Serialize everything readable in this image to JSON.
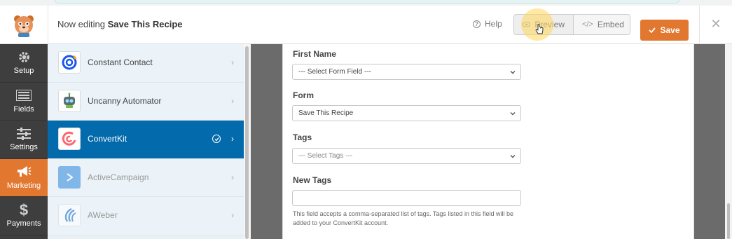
{
  "header": {
    "editing_prefix": "Now editing",
    "form_name": "Save This Recipe",
    "help_label": "Help",
    "preview_label": "Preview",
    "embed_label": "Embed",
    "save_label": "Save"
  },
  "sidebar": {
    "items": [
      {
        "label": "Setup",
        "icon": "gear-icon"
      },
      {
        "label": "Fields",
        "icon": "list-icon"
      },
      {
        "label": "Settings",
        "icon": "sliders-icon"
      },
      {
        "label": "Marketing",
        "icon": "megaphone-icon",
        "active": true
      },
      {
        "label": "Payments",
        "icon": "dollar-icon"
      }
    ]
  },
  "providers": [
    {
      "name": "Constant Contact",
      "icon": "constant-contact-logo"
    },
    {
      "name": "Uncanny Automator",
      "icon": "uncanny-automator-logo"
    },
    {
      "name": "ConvertKit",
      "icon": "convertkit-logo",
      "selected": true,
      "connected": true
    },
    {
      "name": "ActiveCampaign",
      "icon": "activecampaign-logo"
    },
    {
      "name": "AWeber",
      "icon": "aweber-logo"
    }
  ],
  "form": {
    "first_name_label": "First Name",
    "first_name_value": "--- Select Form Field ---",
    "form_label": "Form",
    "form_value": "Save This Recipe",
    "tags_label": "Tags",
    "tags_placeholder": "--- Select Tags ---",
    "new_tags_label": "New Tags",
    "new_tags_value": "",
    "new_tags_help": "This field accepts a comma-separated list of tags. Tags listed in this field will be added to your ConvertKit account."
  },
  "colors": {
    "accent": "#e27730",
    "selected_provider": "#036aab",
    "sidebar_bg": "#3e3e3e"
  }
}
